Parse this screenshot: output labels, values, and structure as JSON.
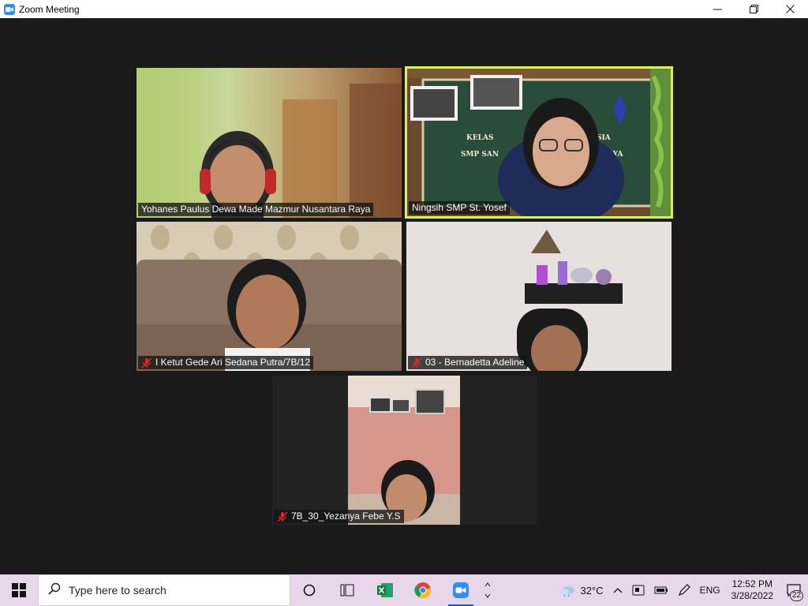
{
  "window": {
    "title": "Zoom Meeting",
    "icon": "zoom-app-icon",
    "controls": [
      "minimize-icon",
      "maximize-icon",
      "close-icon"
    ]
  },
  "participants": [
    {
      "name": "Yohanes Paulus Dewa Made Mazmur Nusantara Raya",
      "muted": false,
      "speaking": false
    },
    {
      "name": "Ningsih SMP St. Yosef",
      "muted": false,
      "speaking": true
    },
    {
      "name": "I Ketut Gede Ari Sedana Putra/7B/12",
      "muted": true,
      "speaking": false
    },
    {
      "name": "03 - Bernadetta Adeline",
      "muted": true,
      "speaking": false
    },
    {
      "name": "7B_30_Yezanya Febe Y.S",
      "muted": true,
      "speaking": false
    }
  ],
  "background_text": {
    "line1": "KELAS",
    "line1_right": "NESIA",
    "line2": "SMP SAN",
    "line2_right": "RABAYA"
  },
  "colors": {
    "active_speaker_border": "#d6f15a",
    "mute_icon": "#e02828",
    "meeting_bg": "#1a1a1a",
    "taskbar_bg": "#e8d7ea"
  },
  "taskbar": {
    "search_placeholder": "Type here to search",
    "pinned": [
      "task-view-icon",
      "excel-icon",
      "chrome-icon",
      "zoom-icon"
    ],
    "active_app": "zoom-icon",
    "weather": "32°C",
    "language": "ENG",
    "time": "12:52 PM",
    "date": "3/28/2022",
    "notifications": "22"
  }
}
